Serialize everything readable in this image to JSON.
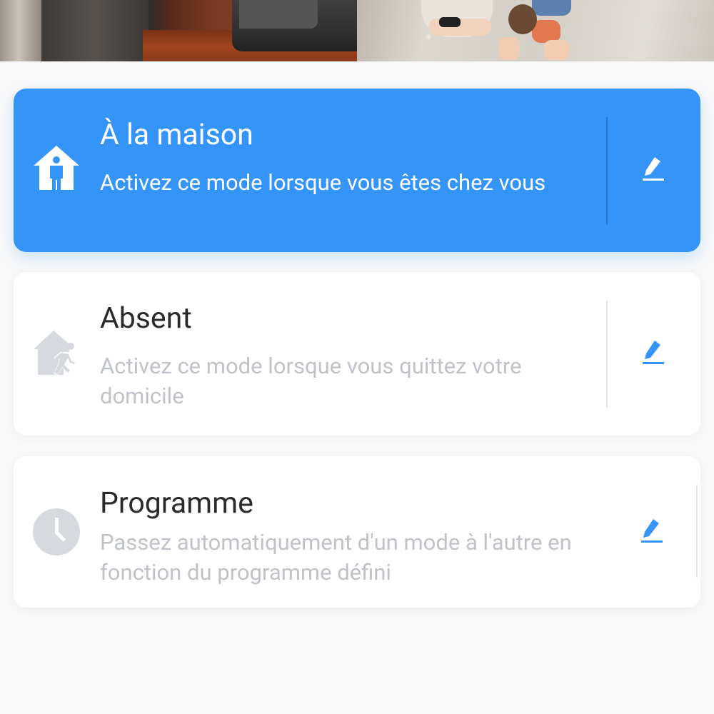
{
  "hero": {
    "description": ""
  },
  "modes": [
    {
      "id": "home",
      "title": "À la maison",
      "description": "Activez ce mode lorsque vous êtes chez vous",
      "icon": "house-person-icon",
      "selected": true
    },
    {
      "id": "away",
      "title": "Absent",
      "description": "Activez ce mode lorsque vous quittez votre domicile",
      "icon": "house-leaving-person-icon",
      "selected": false
    },
    {
      "id": "schedule",
      "title": "Programme",
      "description": "Passez automatiquement d'un mode à l'autre en fonction du programme défini",
      "icon": "clock-icon",
      "selected": false
    }
  ],
  "edit_icon": "pencil-edit-icon",
  "colors": {
    "accent": "#3494f7",
    "background": "#f8f8f9",
    "card": "#ffffff",
    "title": "#2a2a2a",
    "muted": "#bfc2c8",
    "icon_inactive": "#d6d9de"
  }
}
